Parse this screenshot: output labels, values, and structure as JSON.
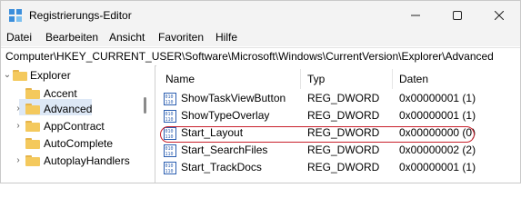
{
  "window": {
    "title": "Registrierungs-Editor"
  },
  "menu": [
    "Datei",
    "Bearbeiten",
    "Ansicht",
    "Favoriten",
    "Hilfe"
  ],
  "address": "Computer\\HKEY_CURRENT_USER\\Software\\Microsoft\\Windows\\CurrentVersion\\Explorer\\Advanced",
  "tree": {
    "parent": "Explorer",
    "items": [
      "Accent",
      "Advanced",
      "AppContract",
      "AutoComplete",
      "AutoplayHandlers"
    ],
    "selected": "Advanced"
  },
  "list": {
    "columns": [
      "Name",
      "Typ",
      "Daten"
    ],
    "rows": [
      {
        "name": "ShowTaskViewButton",
        "type": "REG_DWORD",
        "data": "0x00000001 (1)"
      },
      {
        "name": "ShowTypeOverlay",
        "type": "REG_DWORD",
        "data": "0x00000001 (1)"
      },
      {
        "name": "Start_Layout",
        "type": "REG_DWORD",
        "data": "0x00000000 (0)"
      },
      {
        "name": "Start_SearchFiles",
        "type": "REG_DWORD",
        "data": "0x00000002 (2)"
      },
      {
        "name": "Start_TrackDocs",
        "type": "REG_DWORD",
        "data": "0x00000001 (1)"
      }
    ],
    "highlighted_row": "Start_Layout"
  },
  "colors": {
    "highlight": "#c8202b",
    "selection": "#dde8f6",
    "folder": "#f4c95d"
  }
}
